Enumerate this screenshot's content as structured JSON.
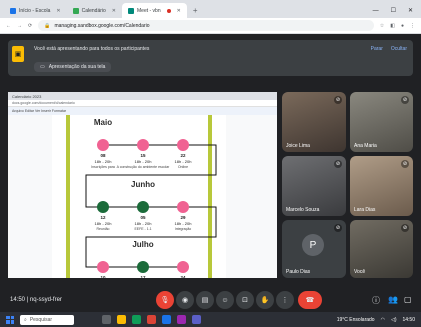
{
  "browser": {
    "tabs": [
      {
        "label": "Início - Escola",
        "color": "#1a73e8",
        "active": false
      },
      {
        "label": "Calendário",
        "color": "#34a853",
        "active": false
      },
      {
        "label": "Meet - vbn",
        "color": "#00897b",
        "active": true
      }
    ],
    "new_tab": "+",
    "url": "managing.sandbox.google.com/Calendario"
  },
  "banner": {
    "message": "Você está apresentando para todos os participantes",
    "action_1": "Parar",
    "action_2": "Ocultar",
    "presenting_chip": "Apresentação da sua tela"
  },
  "shared": {
    "inner_tab": "Calendário 2023",
    "inner_url": "docs.google.com/document/d/calendario",
    "toolbar": "Arquivo Editar Ver Inserir Formatar"
  },
  "calendar": {
    "months": [
      {
        "name": "Maio",
        "events": [
          {
            "day": "08",
            "time": "18h - 20h",
            "label": "Inscrições para"
          },
          {
            "day": "15",
            "time": "18h - 20h",
            "label": "A construção do ambiente escolar"
          },
          {
            "day": "22",
            "time": "18h - 20h",
            "label": "Online"
          }
        ]
      },
      {
        "name": "Junho",
        "events": [
          {
            "day": "12",
            "time": "18h - 20h",
            "label": "Reunião"
          },
          {
            "day": "05",
            "time": "18h - 20h",
            "label": "EEFE - 1.1"
          },
          {
            "day": "29",
            "time": "18h - 20h",
            "label": "Integração"
          }
        ]
      },
      {
        "name": "Julho",
        "events": [
          {
            "day": "10",
            "time": "",
            "label": ""
          },
          {
            "day": "17",
            "time": "",
            "label": ""
          },
          {
            "day": "24",
            "time": "",
            "label": ""
          }
        ]
      }
    ]
  },
  "participants": [
    {
      "name": "Joice Lima",
      "bg": "#5b4a3f"
    },
    {
      "name": "Ana Maria",
      "bg": "#6d6b64"
    },
    {
      "name": "Marcelo Souza",
      "bg": "#55565a"
    },
    {
      "name": "Lara Dias",
      "bg": "#9b8673"
    },
    {
      "name": "Paulo Dias",
      "bg": "#3c4043",
      "initial": "P"
    },
    {
      "name": "Você",
      "bg": "#5a5750"
    }
  ],
  "controls": {
    "time": "14:50 | nq-ssyd-frer"
  },
  "taskbar": {
    "search": "Pesquisar",
    "weather": "19°C Ensolarado",
    "clock": "14:50"
  }
}
